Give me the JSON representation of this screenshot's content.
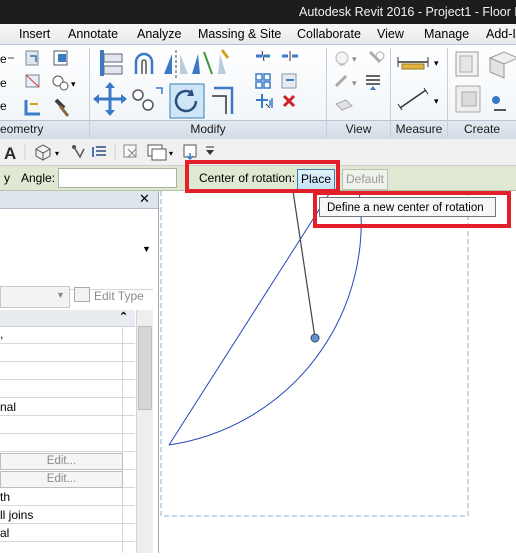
{
  "title_bar": {
    "text": "Autodesk Revit 2016 -    Project1 - Floor P"
  },
  "tabs": [
    "Insert",
    "Annotate",
    "Analyze",
    "Massing & Site",
    "Collaborate",
    "View",
    "Manage",
    "Add-I"
  ],
  "panels": {
    "geometry": "eometry",
    "modify": "Modify",
    "view": "View",
    "measure": "Measure",
    "create": "Create"
  },
  "options_bar": {
    "angle_prefix": "y",
    "angle_label": "Angle:",
    "angle_value": "",
    "center_label": "Center of rotation:",
    "place_button": "Place",
    "default_button": "Default"
  },
  "tooltip": "Define a new center of rotation",
  "properties": {
    "edit_type": "Edit Type",
    "rows": [
      {
        "text": ",",
        "button": ""
      },
      {
        "text": "",
        "button": ""
      },
      {
        "text": "",
        "button": ""
      },
      {
        "text": "",
        "button": ""
      },
      {
        "text": "nal",
        "button": ""
      },
      {
        "text": "",
        "button": ""
      },
      {
        "text": "",
        "button": ""
      },
      {
        "text": "",
        "button": "Edit..."
      },
      {
        "text": "",
        "button": "Edit..."
      },
      {
        "text": "th",
        "button": ""
      },
      {
        "text": "ll joins",
        "button": ""
      },
      {
        "text": "al",
        "button": ""
      },
      {
        "text": "",
        "button": ""
      }
    ]
  },
  "colors": {
    "title_bar": "#1d1d1d",
    "options_bar": "#dfe8d2",
    "highlight": "#e3202a",
    "sketch_line": "#2646b8",
    "pivot": "#6a8fc9"
  },
  "icons": [
    "cut-icon",
    "join-icon",
    "paint-icon",
    "align-icon",
    "offset-icon",
    "mirror-axis-icon",
    "mirror-draw-icon",
    "split-icon",
    "move-icon",
    "copy-icon",
    "rotate-icon",
    "trim-icon",
    "array-icon",
    "scale-icon",
    "pin-icon",
    "unpin-icon",
    "delete-icon",
    "hide-icon",
    "override-icon",
    "measure-icon",
    "dimension-icon",
    "create-assembly-icon",
    "create-parts-icon",
    "text-icon",
    "3d-view-icon",
    "tag-icon",
    "thin-lines-icon",
    "close-hidden-icon",
    "switch-windows-icon",
    "dropdown-icon"
  ]
}
